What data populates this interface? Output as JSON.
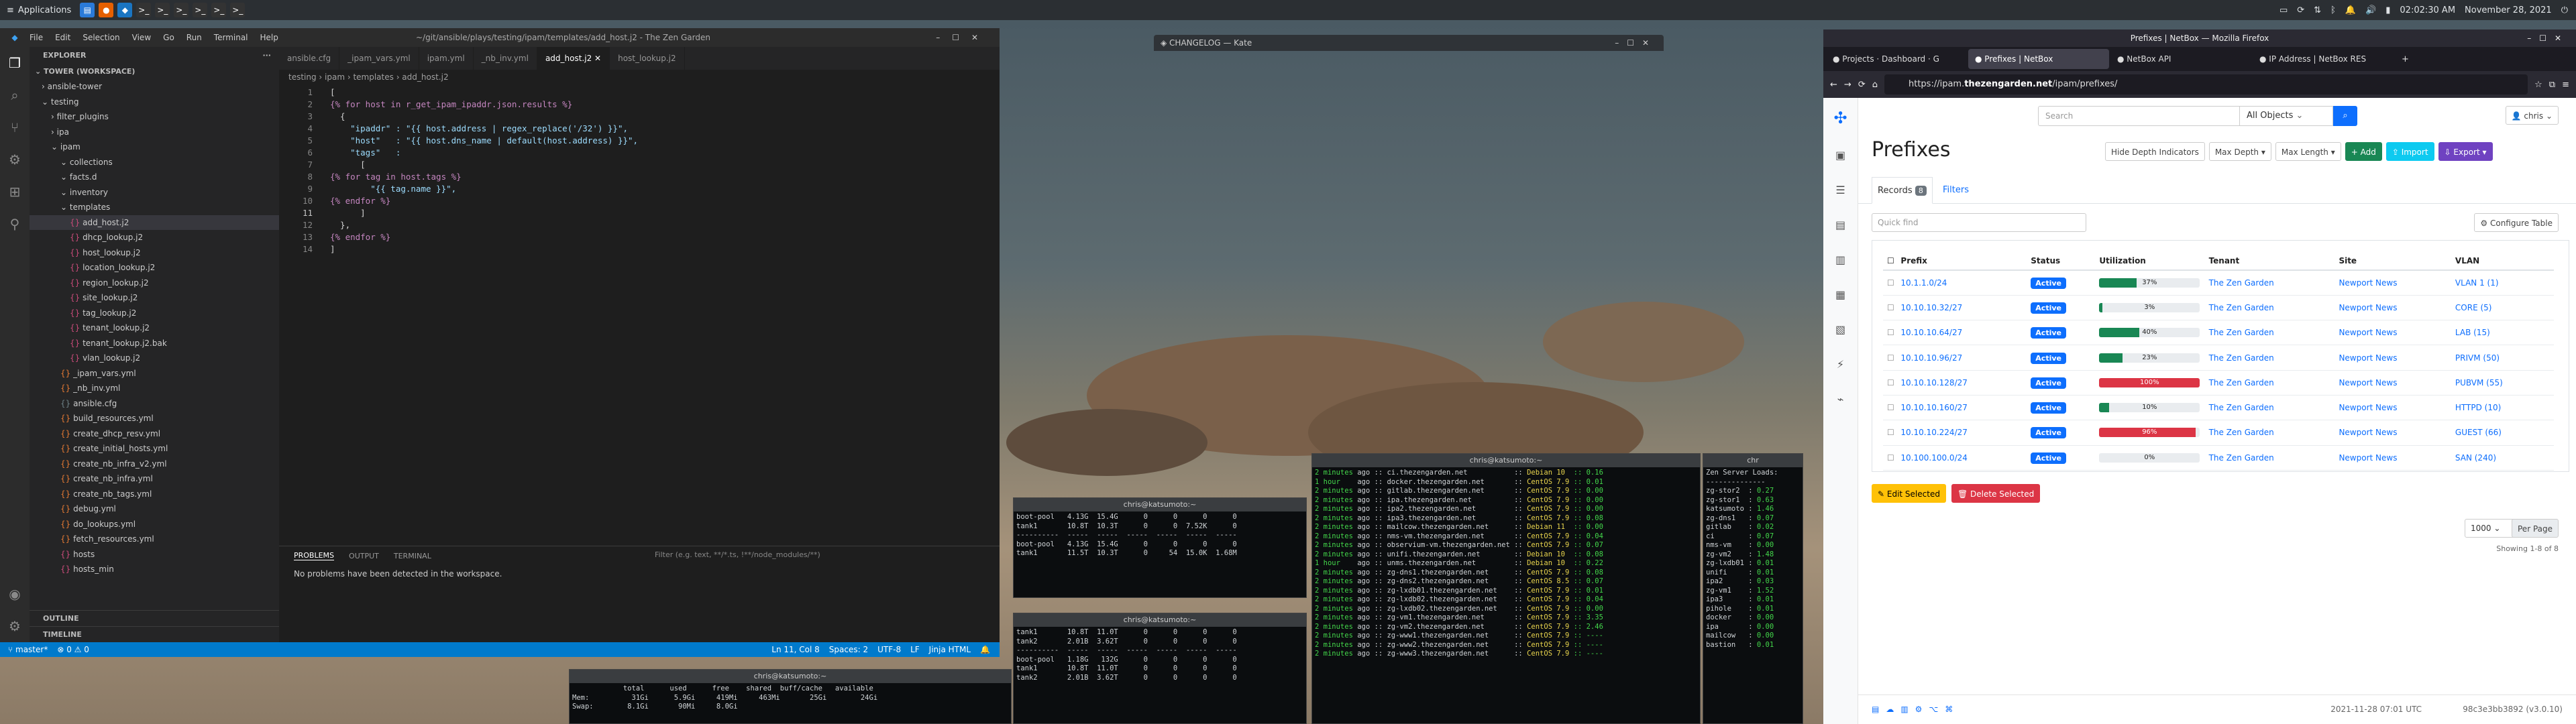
{
  "panel": {
    "apps": "Applications",
    "time": "02:02:30 AM",
    "date": "November 28, 2021"
  },
  "vscode": {
    "title": "~/git/ansible/plays/testing/ipam/templates/add_host.j2 - The Zen Garden",
    "menu": [
      "File",
      "Edit",
      "Selection",
      "View",
      "Go",
      "Run",
      "Terminal",
      "Help"
    ],
    "explorer": "EXPLORER",
    "workspace": "TOWER (WORKSPACE)",
    "tree": [
      "ansible-tower",
      "testing",
      "filter_plugins",
      "ipa",
      "ipam",
      "collections",
      "facts.d",
      "inventory",
      "templates",
      "add_host.j2",
      "dhcp_lookup.j2",
      "host_lookup.j2",
      "location_lookup.j2",
      "region_lookup.j2",
      "site_lookup.j2",
      "tag_lookup.j2",
      "tenant_lookup.j2",
      "tenant_lookup.j2.bak",
      "vlan_lookup.j2",
      "_ipam_vars.yml",
      "_nb_inv.yml",
      "ansible.cfg",
      "build_resources.yml",
      "create_dhcp_resv.yml",
      "create_initial_hosts.yml",
      "create_nb_infra_v2.yml",
      "create_nb_infra.yml",
      "create_nb_tags.yml",
      "debug.yml",
      "do_lookups.yml",
      "fetch_resources.yml",
      "hosts",
      "hosts_min"
    ],
    "outline": "OUTLINE",
    "timeline": "TIMELINE",
    "tabs": [
      "ansible.cfg",
      "_ipam_vars.yml",
      "ipam.yml",
      "_nb_inv.yml",
      "add_host.j2",
      "host_lookup.j2"
    ],
    "breadcrumb": "testing › ipam › templates › add_host.j2",
    "code": [
      "[",
      "{% for host in r_get_ipam_ipaddr.json.results %}",
      "  {",
      "    \"ipaddr\" : \"{{ host.address | regex_replace('/32') }}\",",
      "    \"host\"   : \"{{ host.dns_name | default(host.address) }}\",",
      "    \"tags\"   :",
      "      [",
      "{% for tag in host.tags %}",
      "        \"{{ tag.name }}\",",
      "{% endfor %}",
      "      ]",
      "  },",
      "{% endfor %}",
      "]"
    ],
    "panel_tabs": [
      "PROBLEMS",
      "OUTPUT",
      "TERMINAL"
    ],
    "filter_placeholder": "Filter (e.g. text, **/*.ts, !**/node_modules/**)",
    "problems_msg": "No problems have been detected in the workspace.",
    "status": {
      "branch": "master*",
      "errors": "⊗ 0 ⚠ 0",
      "pos": "Ln 11, Col 8",
      "spaces": "Spaces: 2",
      "enc": "UTF-8",
      "eol": "LF",
      "lang": "Jinja HTML"
    }
  },
  "kate": {
    "title": "CHANGELOG — Kate"
  },
  "terminals": {
    "t1": {
      "title": "chris@katsumoto:~",
      "text": "boot-pool   4.13G  15.4G      0      0      0      0\ntank1       10.8T  10.3T      0      0  7.52K      0\n----------  -----  -----  -----  -----  -----  -----\nboot-pool   4.13G  15.4G      0      0      0      0\ntank1       11.5T  10.3T      0     54  15.0K  1.68M"
    },
    "t2": {
      "title": "chris@katsumoto:~",
      "text": "tank1       10.8T  11.0T      0      0      0      0\ntank2       2.01B  3.62T      0      0      0      0\n----------  -----  -----  -----  -----  -----  -----\nboot-pool   1.18G   132G      0      0      0      0\ntank1       10.8T  11.0T      0      0      0      0\ntank2       2.01B  3.62T      0      0      0      0"
    },
    "t3": {
      "title": "chris@katsumoto:~",
      "text": "            total      used      free    shared  buff/cache   available\nMem:          31Gi      5.9Gi     419Mi     463Mi       25Gi        24Gi\nSwap:        8.1Gi       90Mi     8.0Gi"
    },
    "t4": {
      "title": "chris@katsumoto:~",
      "lines": [
        [
          "2 minutes",
          "ci.thezengarden.net",
          "Debian 10",
          "0.16"
        ],
        [
          "1 hour",
          "docker.thezengarden.net",
          "CentOS 7.9",
          "0.01"
        ],
        [
          "2 minutes",
          "gitlab.thezengarden.net",
          "CentOS 7.9",
          "0.00"
        ],
        [
          "2 minutes",
          "ipa.thezengarden.net",
          "CentOS 7.9",
          "0.00"
        ],
        [
          "2 minutes",
          "ipa2.thezengarden.net",
          "CentOS 7.9",
          "0.00"
        ],
        [
          "2 minutes",
          "ipa3.thezengarden.net",
          "CentOS 7.9",
          "0.08"
        ],
        [
          "2 minutes",
          "mailcow.thezengarden.net",
          "Debian 11",
          "0.00"
        ],
        [
          "2 minutes",
          "nms-vm.thezengarden.net",
          "CentOS 7.9",
          "0.04"
        ],
        [
          "2 minutes",
          "observium-vm.thezengarden.net",
          "CentOS 7.9",
          "0.07"
        ],
        [
          "2 minutes",
          "unifi.thezengarden.net",
          "Debian 10",
          "0.08"
        ],
        [
          "1 hour",
          "unms.thezengarden.net",
          "Debian 10",
          "0.22"
        ],
        [
          "2 minutes",
          "zg-dns1.thezengarden.net",
          "CentOS 7.9",
          "0.08"
        ],
        [
          "2 minutes",
          "zg-dns2.thezengarden.net",
          "CentOS 8.5",
          "0.07"
        ],
        [
          "2 minutes",
          "zg-lxdb01.thezengarden.net",
          "CentOS 7.9",
          "0.01"
        ],
        [
          "2 minutes",
          "zg-lxdb02.thezengarden.net",
          "CentOS 7.9",
          "0.04"
        ],
        [
          "2 minutes",
          "zg-lxdb02.thezengarden.net",
          "CentOS 7.9",
          "0.00"
        ],
        [
          "2 minutes",
          "zg-vm1.thezengarden.net",
          "CentOS 7.9",
          "3.35"
        ],
        [
          "2 minutes",
          "zg-vm2.thezengarden.net",
          "CentOS 7.9",
          "2.46"
        ],
        [
          "2 minutes",
          "zg-www1.thezengarden.net",
          "CentOS 7.9",
          "----"
        ],
        [
          "2 minutes",
          "zg-www2.thezengarden.net",
          "CentOS 7.9",
          "----"
        ],
        [
          "2 minutes",
          "zg-www3.thezengarden.net",
          "CentOS 7.9",
          "----"
        ]
      ]
    },
    "t5": {
      "title": "chr",
      "header": "Zen Server Loads:",
      "lines": [
        [
          "zg-stor2",
          "0.27"
        ],
        [
          "zg-stor1",
          "0.63"
        ],
        [
          "katsumoto",
          "1.46"
        ],
        [
          "zg-dns1",
          "0.07"
        ],
        [
          "gitlab",
          "0.02"
        ],
        [
          "ci",
          "0.07"
        ],
        [
          "nms-vm",
          "0.00"
        ],
        [
          "zg-vm2",
          "1.48"
        ],
        [
          "zg-lxdb01",
          "0.01"
        ],
        [
          "unifi",
          "0.01"
        ],
        [
          "ipa2",
          "0.03"
        ],
        [
          "zg-vm1",
          "1.52"
        ],
        [
          "ipa3",
          "0.01"
        ],
        [
          "pihole",
          "0.01"
        ],
        [
          "docker",
          "0.00"
        ],
        [
          "ipa",
          "0.00"
        ],
        [
          "mailcow",
          "0.00"
        ],
        [
          "bastion",
          "0.01"
        ]
      ]
    }
  },
  "firefox": {
    "title": "Prefixes | NetBox — Mozilla Firefox",
    "tabs": [
      "Projects · Dashboard · G",
      "Prefixes | NetBox",
      "NetBox API",
      "IP Address | NetBox RES"
    ],
    "url_host": "https://ipam.",
    "url_bold": "thezengarden.net",
    "url_rest": "/ipam/prefixes/",
    "netbox": {
      "search_placeholder": "Search",
      "search_scope": "All Objects",
      "user": "chris",
      "heading": "Prefixes",
      "buttons": {
        "hide_depth": "Hide Depth Indicators",
        "max_depth": "Max Depth",
        "max_length": "Max Length",
        "add": "+ Add",
        "import": "Import",
        "export": "Export"
      },
      "tab_records": "Records",
      "record_count": "8",
      "tab_filters": "Filters",
      "quick_find": "Quick find",
      "configure": "Configure Table",
      "columns": [
        "Prefix",
        "Status",
        "Utilization",
        "Tenant",
        "Site",
        "VLAN"
      ],
      "rows": [
        {
          "prefix": "10.1.1.0/24",
          "status": "Active",
          "util": 37,
          "util_label": "37%",
          "tenant": "The Zen Garden",
          "site": "Newport News",
          "vlan": "VLAN 1 (1)"
        },
        {
          "prefix": "10.10.10.32/27",
          "status": "Active",
          "util": 3,
          "util_label": "3%",
          "tenant": "The Zen Garden",
          "site": "Newport News",
          "vlan": "CORE (5)"
        },
        {
          "prefix": "10.10.10.64/27",
          "status": "Active",
          "util": 40,
          "util_label": "40%",
          "tenant": "The Zen Garden",
          "site": "Newport News",
          "vlan": "LAB (15)"
        },
        {
          "prefix": "10.10.10.96/27",
          "status": "Active",
          "util": 23,
          "util_label": "23%",
          "tenant": "The Zen Garden",
          "site": "Newport News",
          "vlan": "PRIVM (50)"
        },
        {
          "prefix": "10.10.10.128/27",
          "status": "Active",
          "util": 100,
          "util_label": "100%",
          "tenant": "The Zen Garden",
          "site": "Newport News",
          "vlan": "PUBVM (55)"
        },
        {
          "prefix": "10.10.10.160/27",
          "status": "Active",
          "util": 10,
          "util_label": "10%",
          "tenant": "The Zen Garden",
          "site": "Newport News",
          "vlan": "HTTPD (10)"
        },
        {
          "prefix": "10.10.10.224/27",
          "status": "Active",
          "util": 96,
          "util_label": "96%",
          "tenant": "The Zen Garden",
          "site": "Newport News",
          "vlan": "GUEST (66)"
        },
        {
          "prefix": "10.100.100.0/24",
          "status": "Active",
          "util": 0,
          "util_label": "0%",
          "tenant": "The Zen Garden",
          "site": "Newport News",
          "vlan": "SAN (240)"
        }
      ],
      "edit_selected": "✎ Edit Selected",
      "delete_selected": "🗑 Delete Selected",
      "per_page_value": "1000",
      "per_page": "Per Page",
      "showing": "Showing 1-8 of 8",
      "footer_time": "2021-11-28 07:01 UTC",
      "footer_ver": "98c3e3bb3892 (v3.0.10)"
    }
  },
  "colors": {
    "vs_blue": "#007acc",
    "util_green": "#198754",
    "util_red": "#dc3545",
    "netbox_blue": "#0d6efd",
    "warning": "#ffc107",
    "danger": "#dc3545"
  }
}
